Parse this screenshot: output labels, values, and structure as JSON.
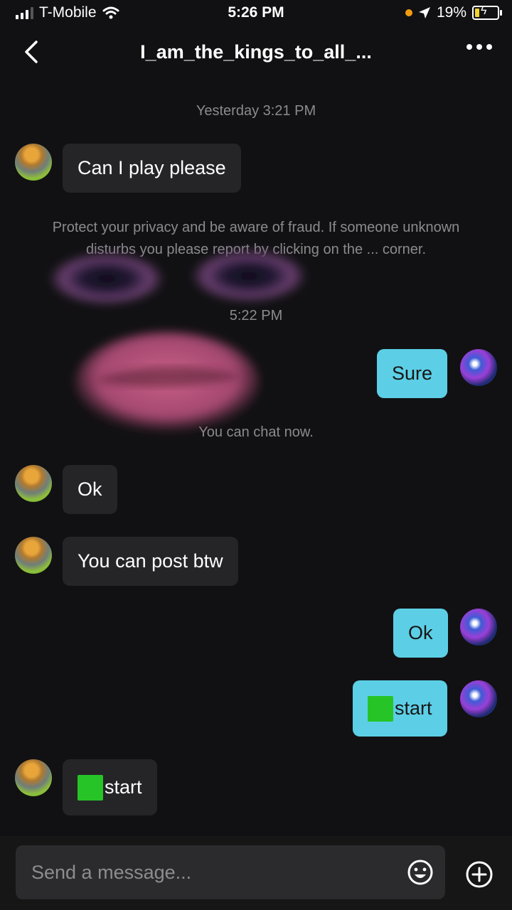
{
  "status_bar": {
    "carrier": "T-Mobile",
    "time": "5:26 PM",
    "battery": "19%"
  },
  "header": {
    "title": "I_am_the_kings_to_all_..."
  },
  "conversation": {
    "timestamp_1": "Yesterday 3:21 PM",
    "notice": "Protect your privacy and be aware of fraud. If someone unknown disturbs you please report by clicking on the ... corner.",
    "timestamp_2": "5:22 PM",
    "chat_notice": "You can chat now.",
    "messages": [
      {
        "from": "them",
        "text": "Can I play please"
      },
      {
        "from": "me",
        "text": "Sure"
      },
      {
        "from": "them",
        "text": "Ok"
      },
      {
        "from": "them",
        "text": "You can post btw"
      },
      {
        "from": "me",
        "text": "Ok"
      },
      {
        "from": "me",
        "text": "start",
        "prefix_icon": "green-square"
      },
      {
        "from": "them",
        "text": "start",
        "prefix_icon": "green-square"
      }
    ]
  },
  "composer": {
    "placeholder": "Send a message..."
  },
  "colors": {
    "background": "#111113",
    "incoming_bubble": "#252527",
    "outgoing_bubble": "#5ccfe6",
    "green_square": "#27c427"
  }
}
